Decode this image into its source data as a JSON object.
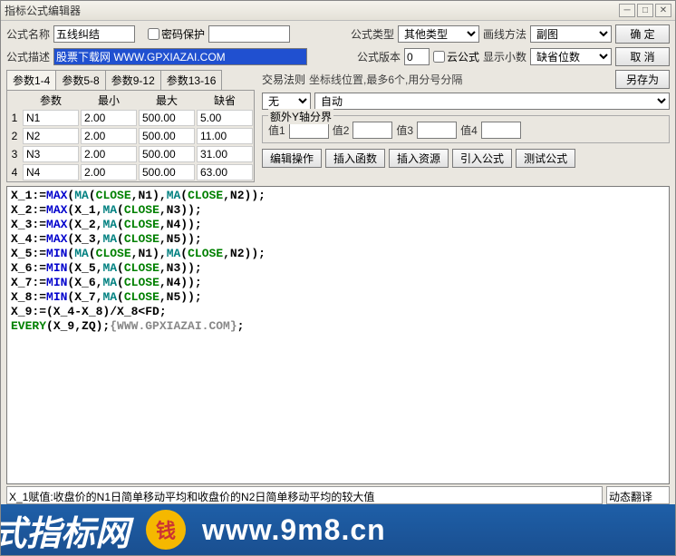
{
  "title": "指标公式编辑器",
  "row1": {
    "name_label": "公式名称",
    "name_value": "五线纠结",
    "pwd_label": "密码保护",
    "type_label": "公式类型",
    "type_value": "其他类型",
    "draw_label": "画线方法",
    "draw_value": "副图",
    "ok": "确  定"
  },
  "row2": {
    "desc_label": "公式描述",
    "desc_value": "股票下载网 WWW.GPXIAZAI.COM",
    "ver_label": "公式版本",
    "ver_value": "0",
    "cloud_label": "云公式",
    "dec_label": "显示小数",
    "dec_value": "缺省位数",
    "cancel": "取  消"
  },
  "tabs": [
    "参数1-4",
    "参数5-8",
    "参数9-12",
    "参数13-16"
  ],
  "phdr": {
    "c1": "参数",
    "c2": "最小",
    "c3": "最大",
    "c4": "缺省"
  },
  "params": [
    {
      "i": "1",
      "n": "N1",
      "min": "2.00",
      "max": "500.00",
      "def": "5.00"
    },
    {
      "i": "2",
      "n": "N2",
      "min": "2.00",
      "max": "500.00",
      "def": "11.00"
    },
    {
      "i": "3",
      "n": "N3",
      "min": "2.00",
      "max": "500.00",
      "def": "31.00"
    },
    {
      "i": "4",
      "n": "N4",
      "min": "2.00",
      "max": "500.00",
      "def": "63.00"
    }
  ],
  "rule": {
    "label": "交易法则",
    "hint": "坐标线位置,最多6个,用分号分隔",
    "v1": "无",
    "v2": "自动",
    "saveas": "另存为"
  },
  "extra": {
    "legend": "额外Y轴分界",
    "v1": "值1",
    "v2": "值2",
    "v3": "值3",
    "v4": "值4"
  },
  "btns": {
    "edit": "编辑操作",
    "func": "插入函数",
    "res": "插入资源",
    "imp": "引入公式",
    "test": "测试公式"
  },
  "status": "X_1赋值:收盘价的N1日简单移动平均和收盘价的N2日简单移动平均的较大值",
  "status2": "动态翻译",
  "banner": {
    "left": "式指标网",
    "url": "www.9m8.cn"
  }
}
